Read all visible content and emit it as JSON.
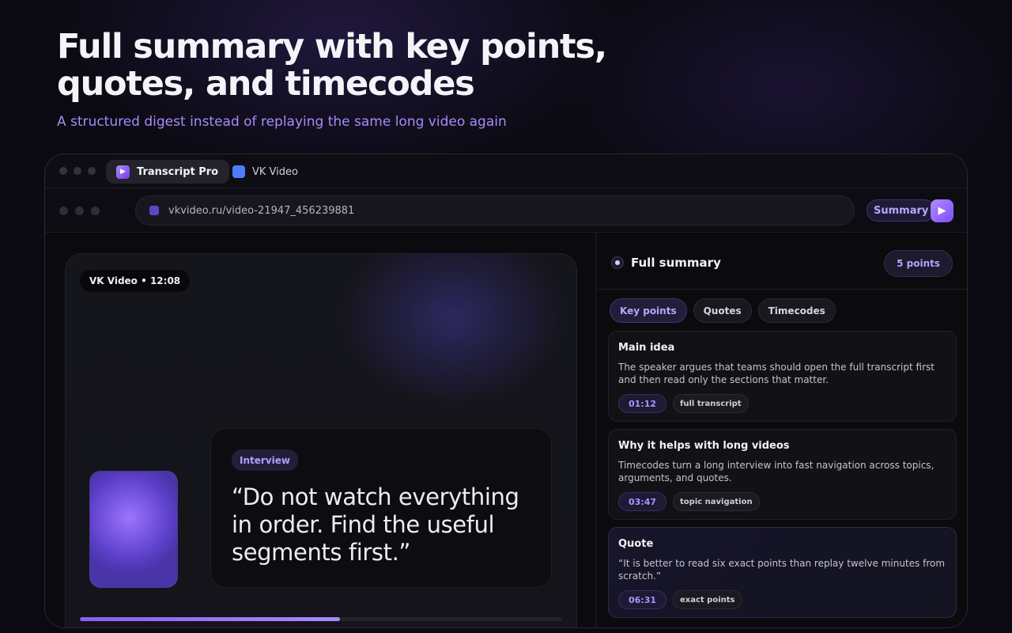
{
  "hero": {
    "title": "Full summary with key points, quotes, and timecodes",
    "subtitle": "A structured digest instead of replaying the same long video again"
  },
  "browser": {
    "tabs": [
      {
        "label": "Transcript Pro",
        "active": true
      },
      {
        "label": "VK Video",
        "active": false
      }
    ],
    "url": "vkvideo.ru/video-21947_456239881",
    "summary_button": "Summary",
    "extension_icon": "play-icon"
  },
  "player": {
    "badge": "VK Video • 12:08",
    "quote_tag": "Interview",
    "quote_text": "“Do not watch everything in order. Find the useful segments first.”",
    "progress": 0.54
  },
  "panel": {
    "title": "Full summary",
    "points_badge": "5 points",
    "tabs": [
      {
        "label": "Key points",
        "active": true
      },
      {
        "label": "Quotes",
        "active": false
      },
      {
        "label": "Timecodes",
        "active": false
      }
    ],
    "cards": [
      {
        "title": "Main idea",
        "text": "The speaker argues that teams should open the full transcript first and then read only the sections that matter.",
        "timecode": "01:12",
        "tag": "full transcript"
      },
      {
        "title": "Why it helps with long videos",
        "text": "Timecodes turn a long interview into fast navigation across topics, arguments, and quotes.",
        "timecode": "03:47",
        "tag": "topic navigation"
      },
      {
        "title": "Quote",
        "text": "“It is better to read six exact points than replay twelve minutes from scratch.”",
        "timecode": "06:31",
        "tag": "exact points"
      }
    ]
  },
  "colors": {
    "accent": "#a78bfa",
    "accent_deep": "#7c3aed",
    "background": "#0b0a12"
  }
}
